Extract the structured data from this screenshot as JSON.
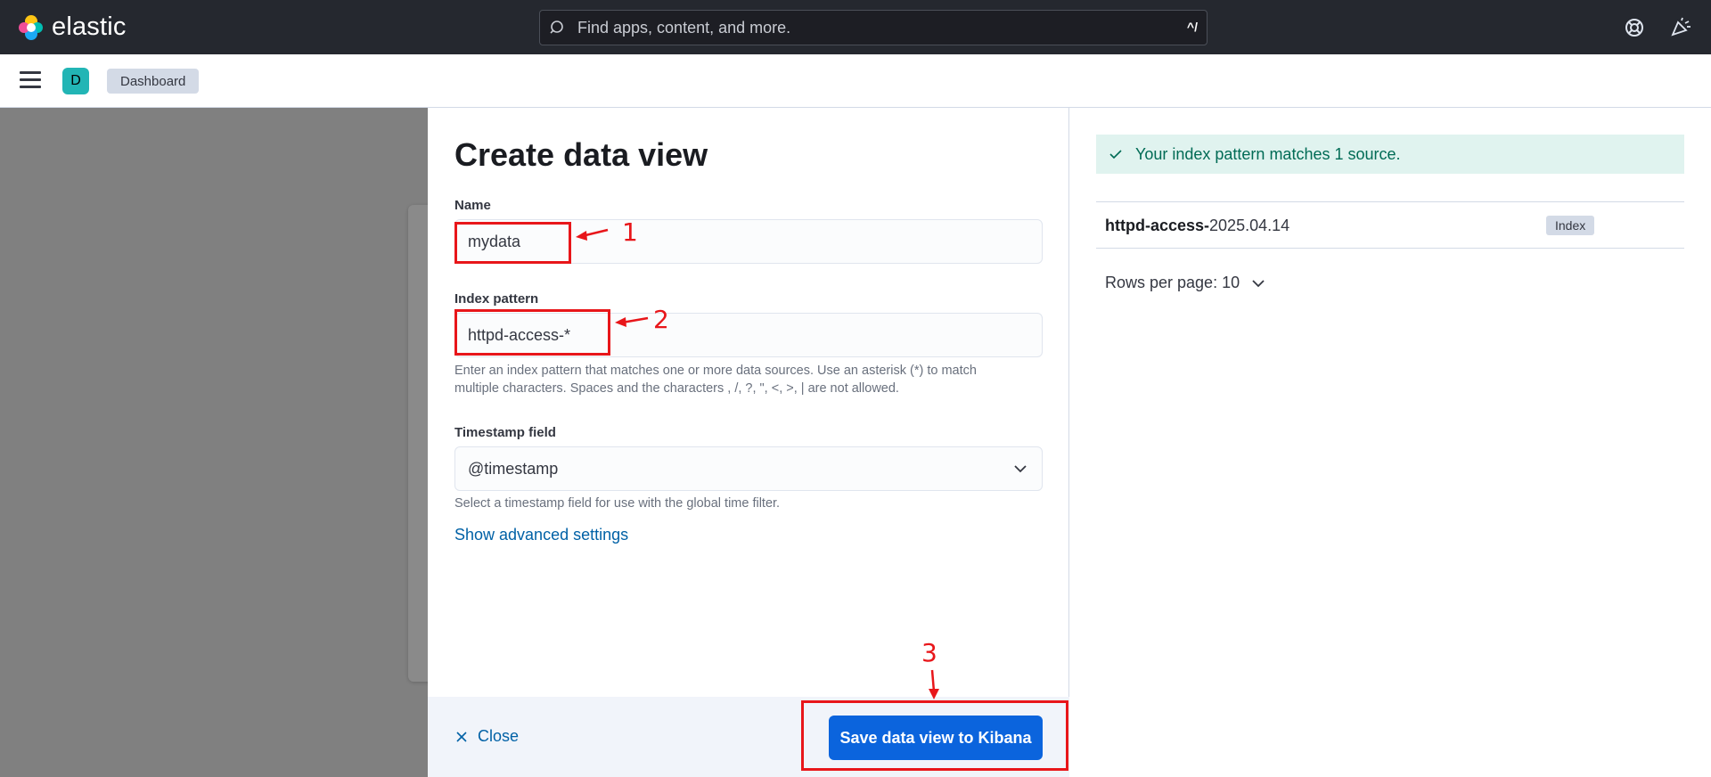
{
  "header": {
    "app_name": "elastic",
    "search_placeholder": "Find apps, content, and more.",
    "search_shortcut": "^/"
  },
  "subnav": {
    "space_initial": "D",
    "breadcrumb": "Dashboard"
  },
  "flyout": {
    "title": "Create data view",
    "name_label": "Name",
    "name_value": "mydata",
    "index_label": "Index pattern",
    "index_value": "httpd-access-*",
    "index_help_line1": "Enter an index pattern that matches one or more data sources. Use an asterisk (*) to match",
    "index_help_line2": "multiple characters. Spaces and the characters , /, ?, \", <, >, | are not allowed.",
    "timestamp_label": "Timestamp field",
    "timestamp_value": "@timestamp",
    "timestamp_help": "Select a timestamp field for use with the global time filter.",
    "advanced_link": "Show advanced settings",
    "close_label": "Close",
    "save_label": "Save data view to Kibana"
  },
  "preview": {
    "match_message": "Your index pattern matches 1 source.",
    "rows": [
      {
        "name_bold": "httpd-access-",
        "name_rest": "2025.04.14",
        "type": "Index"
      }
    ],
    "rows_per_page": "Rows per page: 10"
  },
  "annotations": {
    "step1": "1",
    "step2": "2",
    "step3": "3"
  },
  "colors": {
    "annotation": "#e8161a",
    "primary": "#0b64dd",
    "header_bg": "#25282f",
    "success_text": "#006b55"
  }
}
